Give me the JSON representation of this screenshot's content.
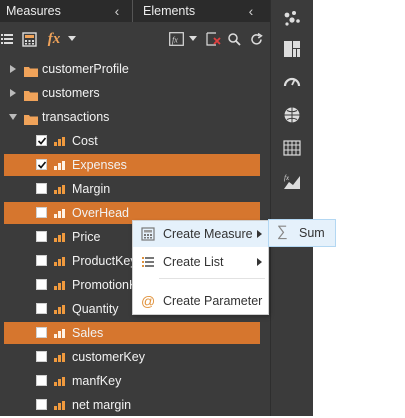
{
  "tabs": {
    "measures": "Measures",
    "elements": "Elements"
  },
  "toolbar": {
    "icons": [
      "tree-view-icon",
      "calculator-icon",
      "fx-icon",
      "dropdown-icon",
      "fx-box-icon",
      "clear-filter-icon",
      "search-icon",
      "refresh-icon"
    ]
  },
  "tree": {
    "folders": [
      {
        "label": "customerProfile",
        "expanded": false
      },
      {
        "label": "customers",
        "expanded": false
      },
      {
        "label": "transactions",
        "expanded": true
      }
    ],
    "measures": [
      {
        "label": "Cost",
        "checked": true,
        "selected": false
      },
      {
        "label": "Expenses",
        "checked": true,
        "selected": true
      },
      {
        "label": "Margin",
        "checked": false,
        "selected": false
      },
      {
        "label": "OverHead",
        "checked": false,
        "selected": true
      },
      {
        "label": "Price",
        "checked": false,
        "selected": false
      },
      {
        "label": "ProductKey",
        "checked": false,
        "selected": false
      },
      {
        "label": "PromotionKey",
        "checked": false,
        "selected": false
      },
      {
        "label": "Quantity",
        "checked": false,
        "selected": false
      },
      {
        "label": "Sales",
        "checked": false,
        "selected": true
      },
      {
        "label": "customerKey",
        "checked": false,
        "selected": false
      },
      {
        "label": "manfKey",
        "checked": false,
        "selected": false
      },
      {
        "label": "net margin",
        "checked": false,
        "selected": false
      }
    ]
  },
  "context_menu": {
    "items": [
      {
        "label": "Create Measure",
        "icon": "calculator-icon",
        "has_submenu": true
      },
      {
        "label": "Create List",
        "icon": "list-icon",
        "has_submenu": true
      },
      {
        "label": "Create Parameter",
        "icon": "at-icon",
        "has_submenu": false
      }
    ],
    "submenu": {
      "label": "Sum",
      "icon": "sigma-icon"
    }
  },
  "right_rail": {
    "icons": [
      "scatter-icon",
      "treemap-icon",
      "gauge-icon",
      "globe-icon",
      "grid-table-icon",
      "fx-chart-icon"
    ]
  },
  "colors": {
    "panel": "#3b3b3b",
    "selection": "#d6762e",
    "bar_icon": "#f09a3e",
    "folder": "#f0a35a"
  }
}
